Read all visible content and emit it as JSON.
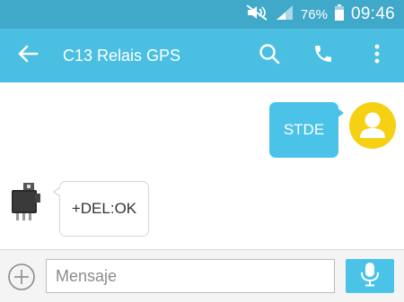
{
  "status_bar": {
    "battery_percent": "76%",
    "time": "09:46",
    "icons": [
      "mute-icon",
      "signal-icon",
      "battery-icon"
    ],
    "background_color": "#40a8c9"
  },
  "app_bar": {
    "title": "C13 Relais GPS",
    "back_icon": "arrow-left-icon",
    "actions": [
      "search-icon",
      "phone-icon",
      "more-vert-icon"
    ],
    "background_color": "#4bbfe2"
  },
  "messages": [
    {
      "direction": "outgoing",
      "text": "STDE",
      "avatar": "user-avatar-icon",
      "bubble_color": "#4bc3e8"
    },
    {
      "direction": "incoming",
      "text": "+DEL:OK",
      "avatar": "relay-device-icon",
      "bubble_color": "#ffffff"
    }
  ],
  "composer": {
    "add_icon": "plus-circle-icon",
    "placeholder": "Mensaje",
    "value": "",
    "mic_icon": "microphone-icon",
    "mic_button_color": "#4bc3e8"
  }
}
